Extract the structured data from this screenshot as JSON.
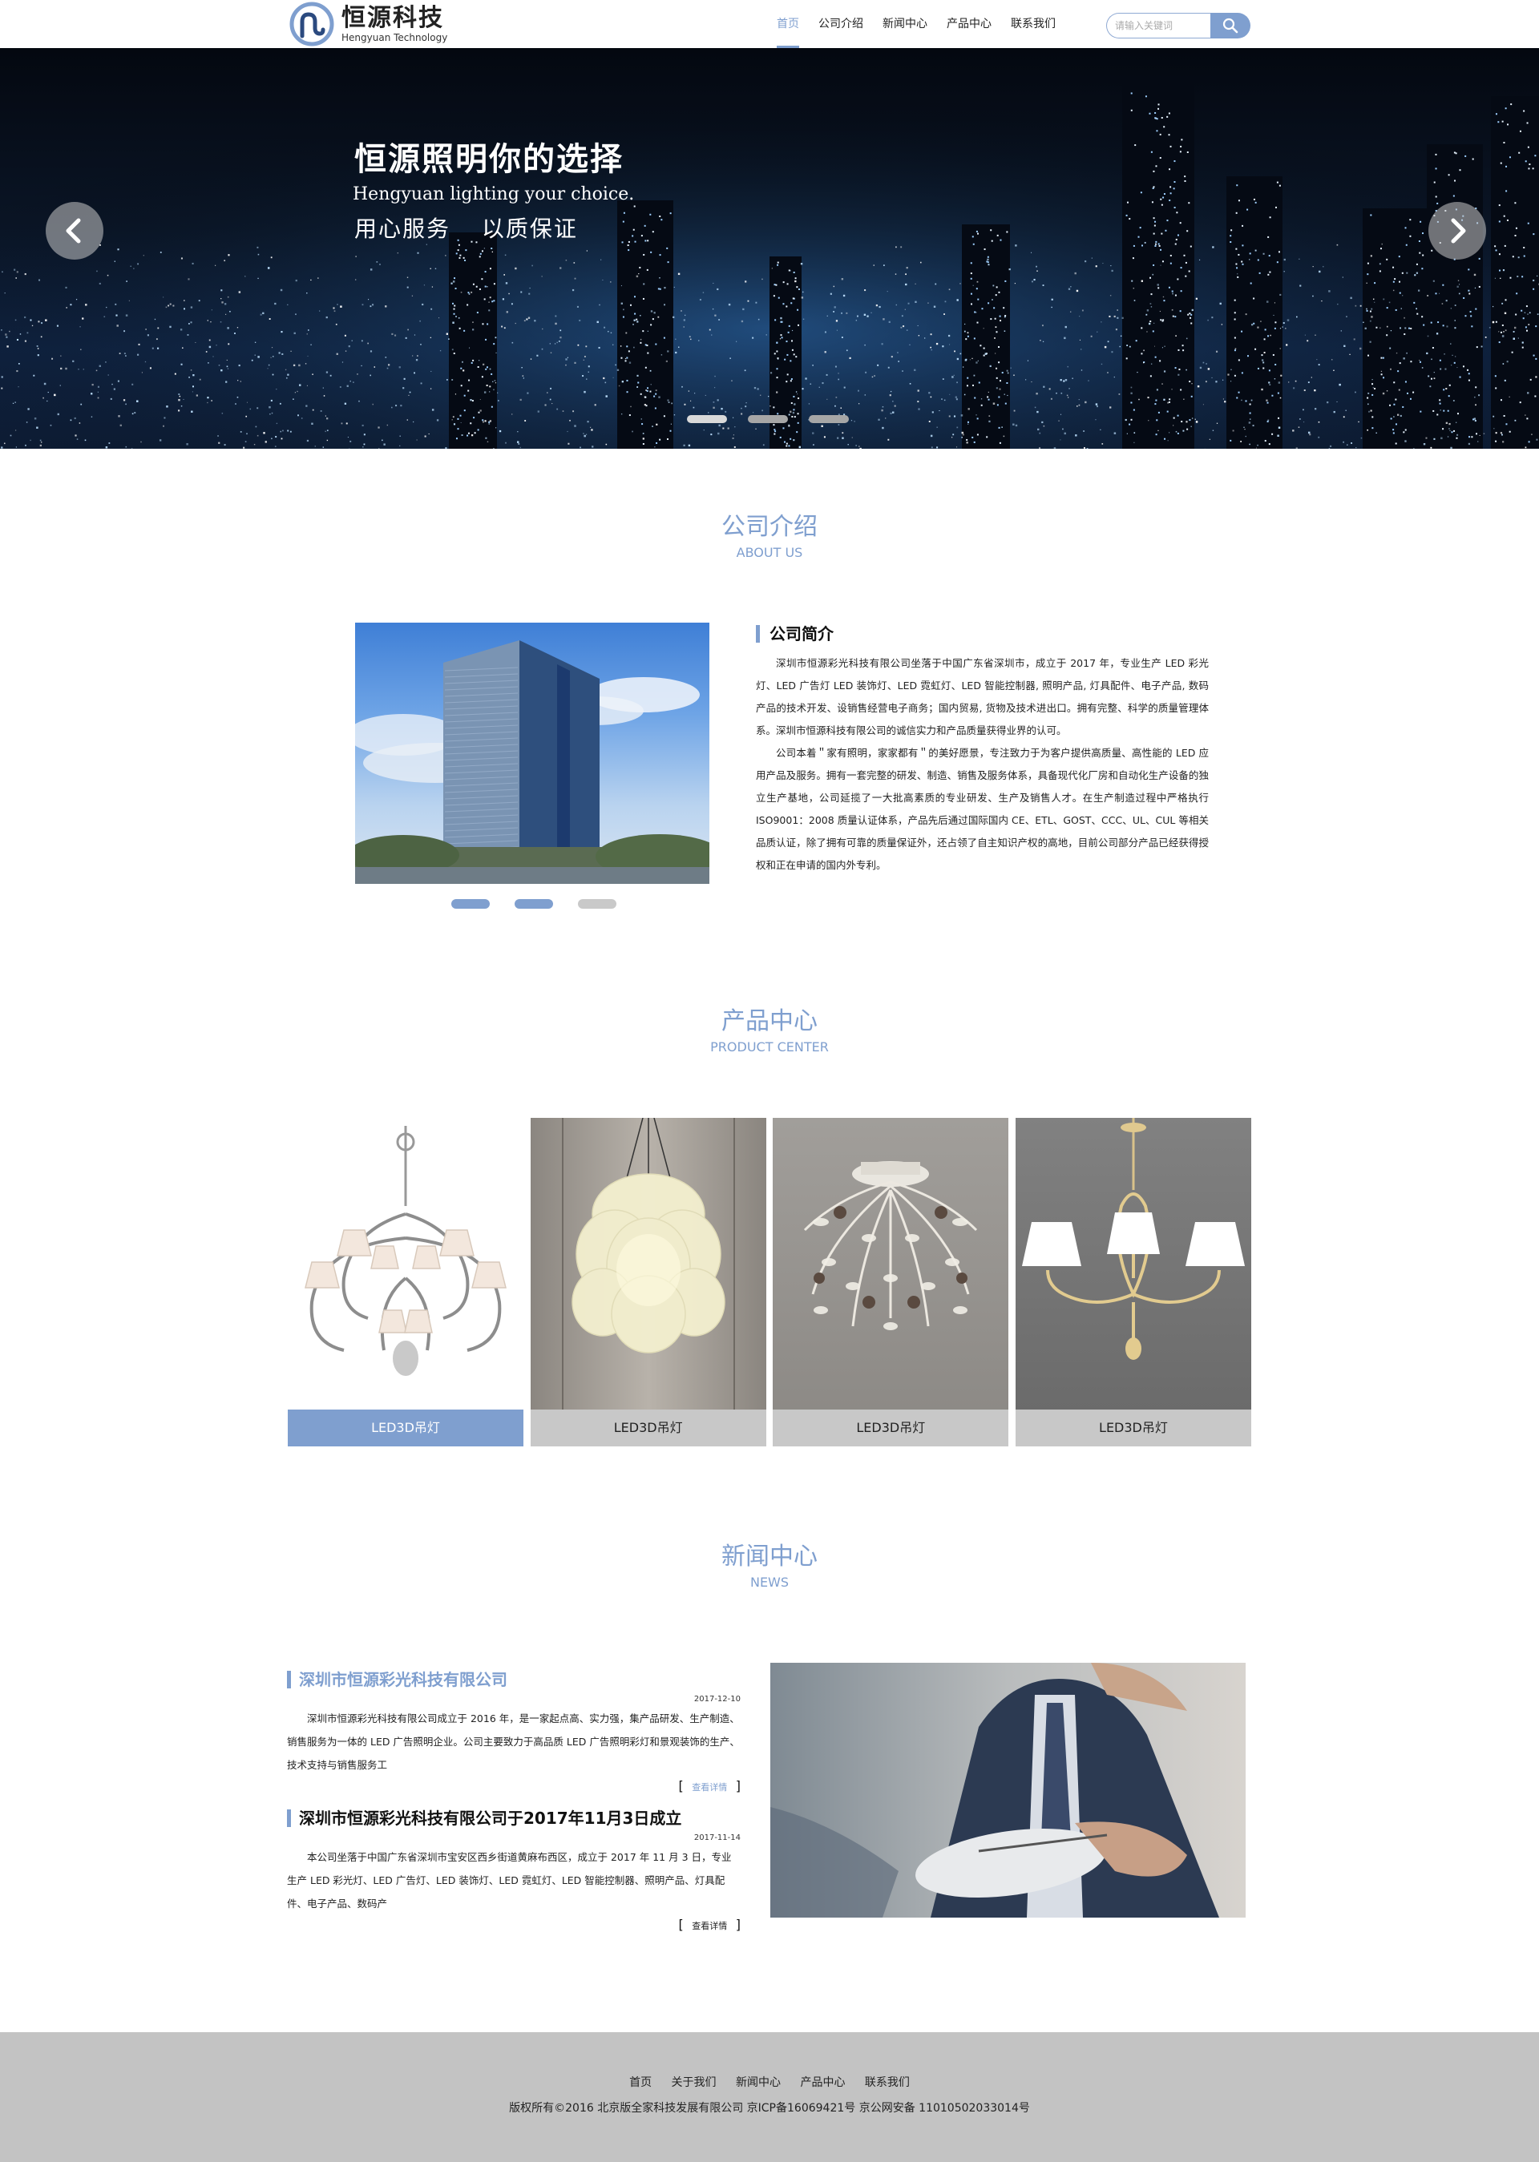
{
  "header": {
    "logo_cn": "恒源科技",
    "logo_en": "Hengyuan Technology",
    "nav": [
      "首页",
      "公司介绍",
      "新闻中心",
      "产品中心",
      "联系我们"
    ],
    "search_placeholder": "请输入关键词"
  },
  "banner": {
    "title": "恒源照明你的选择",
    "subtitle": "Hengyuan lighting your choice.",
    "slogan": "用心服务 以质保证",
    "slide_count": 3,
    "active_slide": 1
  },
  "about": {
    "heading_cn": "公司介绍",
    "heading_en": "ABOUT US",
    "title": "公司简介",
    "p1": "深圳市恒源彩光科技有限公司坐落于中国广东省深圳市，成立于 2017 年，专业生产 LED 彩光灯、LED 广告灯 LED 装饰灯、LED 霓虹灯、LED 智能控制器, 照明产品, 灯具配件、电子产品, 数码产品的技术开发、设销售经营电子商务；国内贸易, 货物及技术进出口。拥有完整、科学的质量管理体系。深圳市恒源科技有限公司的诚信实力和产品质量获得业界的认可。",
    "p2": "公司本着＂家有照明，家家都有＂的美好愿景，专注致力于为客户提供高质量、高性能的 LED 应用产品及服务。拥有一套完整的研发、制造、销售及服务体系，具备现代化厂房和自动化生产设备的独立生产基地，公司延揽了一大批高素质的专业研发、生产及销售人才。在生产制造过程中严格执行 ISO9001：2008 质量认证体系，产品先后通过国际国内 CE、ETL、GOST、CCC、UL、CUL 等相关品质认证，除了拥有可靠的质量保证外，还占领了自主知识产权的高地，目前公司部分产品已经获得授权和正在申请的国内外专利。"
  },
  "products": {
    "heading_cn": "产品中心",
    "heading_en": "PRODUCT CENTER",
    "items": [
      {
        "label": "LED3D吊灯"
      },
      {
        "label": "LED3D吊灯"
      },
      {
        "label": "LED3D吊灯"
      },
      {
        "label": "LED3D吊灯"
      }
    ]
  },
  "news": {
    "heading_cn": "新闻中心",
    "heading_en": "NEWS",
    "more_label": "查看详情",
    "items": [
      {
        "title": "深圳市恒源彩光科技有限公司",
        "date": "2017-12-10",
        "body": "深圳市恒源彩光科技有限公司成立于 2016 年，是一家起点高、实力强，集产品研发、生产制造、销售服务为一体的 LED 广告照明企业。公司主要致力于高品质 LED 广告照明彩灯和景观装饰的生产、技术支持与销售服务工"
      },
      {
        "title": "深圳市恒源彩光科技有限公司于2017年11月3日成立",
        "date": "2017-11-14",
        "body": "本公司坐落于中国广东省深圳市宝安区西乡街道黄麻布西区，成立于 2017 年 11 月 3 日，专业生产 LED 彩光灯、LED 广告灯、LED 装饰灯、LED 霓虹灯、LED 智能控制器、照明产品、灯具配件、电子产品、数码产"
      }
    ]
  },
  "footer": {
    "links": [
      "首页",
      "关于我们",
      "新闻中心",
      "产品中心",
      "联系我们"
    ],
    "copyright": "版权所有©2016  北京版全家科技发展有限公司  京ICP备16069421号    京公网安备  11010502033014号"
  },
  "colors": {
    "accent": "#7f9fcf",
    "footer_bg": "#c3c3c3"
  }
}
